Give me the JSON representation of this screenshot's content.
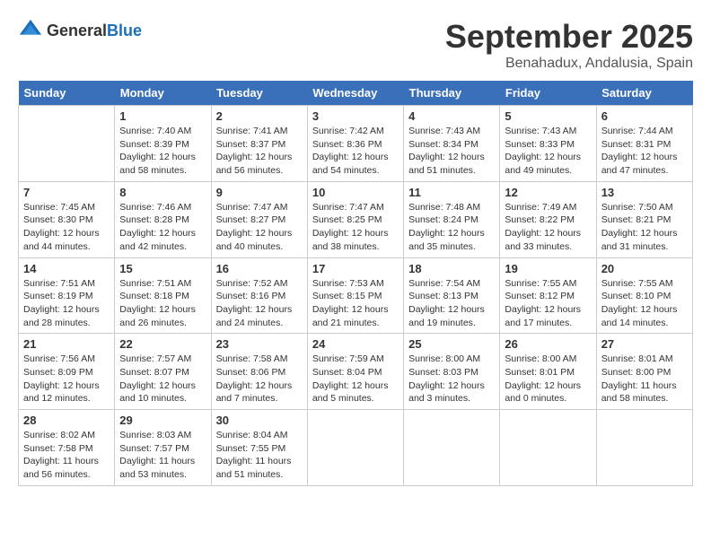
{
  "header": {
    "logo_general": "General",
    "logo_blue": "Blue",
    "month_title": "September 2025",
    "location": "Benahadux, Andalusia, Spain"
  },
  "days_of_week": [
    "Sunday",
    "Monday",
    "Tuesday",
    "Wednesday",
    "Thursday",
    "Friday",
    "Saturday"
  ],
  "weeks": [
    [
      {
        "day": "",
        "info": ""
      },
      {
        "day": "1",
        "info": "Sunrise: 7:40 AM\nSunset: 8:39 PM\nDaylight: 12 hours\nand 58 minutes."
      },
      {
        "day": "2",
        "info": "Sunrise: 7:41 AM\nSunset: 8:37 PM\nDaylight: 12 hours\nand 56 minutes."
      },
      {
        "day": "3",
        "info": "Sunrise: 7:42 AM\nSunset: 8:36 PM\nDaylight: 12 hours\nand 54 minutes."
      },
      {
        "day": "4",
        "info": "Sunrise: 7:43 AM\nSunset: 8:34 PM\nDaylight: 12 hours\nand 51 minutes."
      },
      {
        "day": "5",
        "info": "Sunrise: 7:43 AM\nSunset: 8:33 PM\nDaylight: 12 hours\nand 49 minutes."
      },
      {
        "day": "6",
        "info": "Sunrise: 7:44 AM\nSunset: 8:31 PM\nDaylight: 12 hours\nand 47 minutes."
      }
    ],
    [
      {
        "day": "7",
        "info": "Sunrise: 7:45 AM\nSunset: 8:30 PM\nDaylight: 12 hours\nand 44 minutes."
      },
      {
        "day": "8",
        "info": "Sunrise: 7:46 AM\nSunset: 8:28 PM\nDaylight: 12 hours\nand 42 minutes."
      },
      {
        "day": "9",
        "info": "Sunrise: 7:47 AM\nSunset: 8:27 PM\nDaylight: 12 hours\nand 40 minutes."
      },
      {
        "day": "10",
        "info": "Sunrise: 7:47 AM\nSunset: 8:25 PM\nDaylight: 12 hours\nand 38 minutes."
      },
      {
        "day": "11",
        "info": "Sunrise: 7:48 AM\nSunset: 8:24 PM\nDaylight: 12 hours\nand 35 minutes."
      },
      {
        "day": "12",
        "info": "Sunrise: 7:49 AM\nSunset: 8:22 PM\nDaylight: 12 hours\nand 33 minutes."
      },
      {
        "day": "13",
        "info": "Sunrise: 7:50 AM\nSunset: 8:21 PM\nDaylight: 12 hours\nand 31 minutes."
      }
    ],
    [
      {
        "day": "14",
        "info": "Sunrise: 7:51 AM\nSunset: 8:19 PM\nDaylight: 12 hours\nand 28 minutes."
      },
      {
        "day": "15",
        "info": "Sunrise: 7:51 AM\nSunset: 8:18 PM\nDaylight: 12 hours\nand 26 minutes."
      },
      {
        "day": "16",
        "info": "Sunrise: 7:52 AM\nSunset: 8:16 PM\nDaylight: 12 hours\nand 24 minutes."
      },
      {
        "day": "17",
        "info": "Sunrise: 7:53 AM\nSunset: 8:15 PM\nDaylight: 12 hours\nand 21 minutes."
      },
      {
        "day": "18",
        "info": "Sunrise: 7:54 AM\nSunset: 8:13 PM\nDaylight: 12 hours\nand 19 minutes."
      },
      {
        "day": "19",
        "info": "Sunrise: 7:55 AM\nSunset: 8:12 PM\nDaylight: 12 hours\nand 17 minutes."
      },
      {
        "day": "20",
        "info": "Sunrise: 7:55 AM\nSunset: 8:10 PM\nDaylight: 12 hours\nand 14 minutes."
      }
    ],
    [
      {
        "day": "21",
        "info": "Sunrise: 7:56 AM\nSunset: 8:09 PM\nDaylight: 12 hours\nand 12 minutes."
      },
      {
        "day": "22",
        "info": "Sunrise: 7:57 AM\nSunset: 8:07 PM\nDaylight: 12 hours\nand 10 minutes."
      },
      {
        "day": "23",
        "info": "Sunrise: 7:58 AM\nSunset: 8:06 PM\nDaylight: 12 hours\nand 7 minutes."
      },
      {
        "day": "24",
        "info": "Sunrise: 7:59 AM\nSunset: 8:04 PM\nDaylight: 12 hours\nand 5 minutes."
      },
      {
        "day": "25",
        "info": "Sunrise: 8:00 AM\nSunset: 8:03 PM\nDaylight: 12 hours\nand 3 minutes."
      },
      {
        "day": "26",
        "info": "Sunrise: 8:00 AM\nSunset: 8:01 PM\nDaylight: 12 hours\nand 0 minutes."
      },
      {
        "day": "27",
        "info": "Sunrise: 8:01 AM\nSunset: 8:00 PM\nDaylight: 11 hours\nand 58 minutes."
      }
    ],
    [
      {
        "day": "28",
        "info": "Sunrise: 8:02 AM\nSunset: 7:58 PM\nDaylight: 11 hours\nand 56 minutes."
      },
      {
        "day": "29",
        "info": "Sunrise: 8:03 AM\nSunset: 7:57 PM\nDaylight: 11 hours\nand 53 minutes."
      },
      {
        "day": "30",
        "info": "Sunrise: 8:04 AM\nSunset: 7:55 PM\nDaylight: 11 hours\nand 51 minutes."
      },
      {
        "day": "",
        "info": ""
      },
      {
        "day": "",
        "info": ""
      },
      {
        "day": "",
        "info": ""
      },
      {
        "day": "",
        "info": ""
      }
    ]
  ]
}
